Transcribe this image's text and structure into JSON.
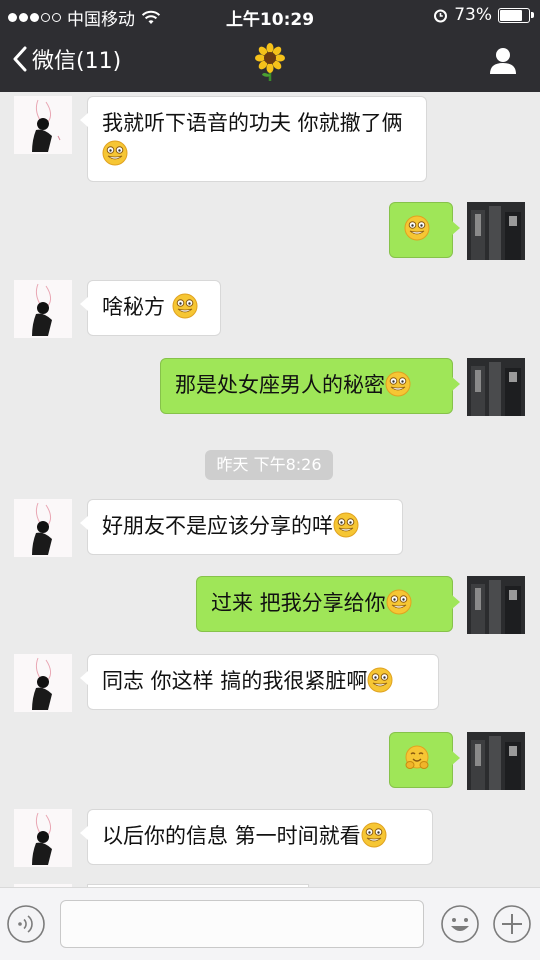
{
  "status_bar": {
    "carrier": "中国移动",
    "time": "上午10:29",
    "battery": "73%",
    "battery_level": 0.73
  },
  "nav": {
    "back_label": "微信(11)",
    "title_icon": "sunflower-emoji",
    "right_icon": "contact-profile-icon"
  },
  "messages": [
    {
      "sender": "them",
      "text": "我就听下语音的功夫 你就撤了俩",
      "emoji": "grin-emoji"
    },
    {
      "sender": "me",
      "text": "",
      "emoji": "grin-emoji"
    },
    {
      "sender": "them",
      "text": "啥秘方 ",
      "emoji": "grin-emoji"
    },
    {
      "sender": "me",
      "text": "那是处女座男人的秘密",
      "emoji": "grin-emoji"
    },
    {
      "sender": "them",
      "text": "好朋友不是应该分享的咩",
      "emoji": "grin-emoji"
    },
    {
      "sender": "me",
      "text": "过来  把我分享给你",
      "emoji": "grin-emoji"
    },
    {
      "sender": "them",
      "text": "同志 你这样 搞的我很紧脏啊",
      "emoji": "grin-emoji"
    },
    {
      "sender": "me",
      "text": "",
      "emoji": "hug-emoji"
    },
    {
      "sender": "them",
      "text": "以后你的信息 第一时间就看",
      "emoji": "grin-emoji"
    }
  ],
  "timestamp": "昨天 下午8:26",
  "input_bar": {
    "placeholder": "",
    "voice_icon": "voice-icon",
    "emoji_icon": "smiley-icon",
    "plus_icon": "plus-icon"
  },
  "colors": {
    "nav_bg": "#2e2e32",
    "chat_bg": "#ebebeb",
    "my_bubble": "#9fe658",
    "their_bubble": "#ffffff"
  }
}
